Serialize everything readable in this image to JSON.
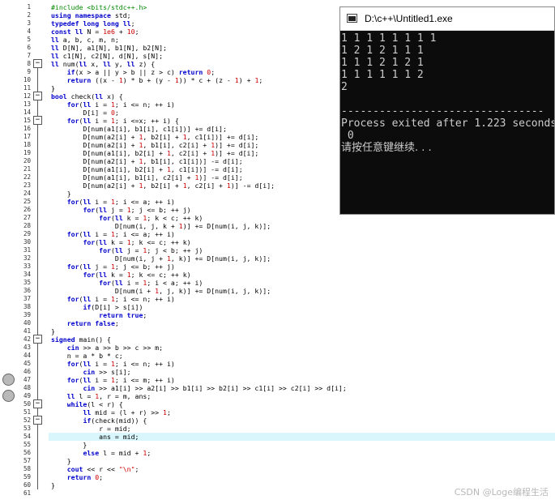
{
  "editor": {
    "lines": [
      "#include <bits/stdc++.h>",
      "using namespace std;",
      "typedef long long ll;",
      "const ll N = 1e6 + 10;",
      "ll a, b, c, m, n;",
      "ll D[N], a1[N], b1[N], b2[N];",
      "ll c1[N], c2[N], d[N], s[N];",
      "ll num(ll x, ll y, ll z) {",
      "    if(x > a || y > b || z > c) return 0;",
      "    return ((x - 1) * b + (y - 1)) * c + (z - 1) + 1;",
      "}",
      "bool check(ll x) {",
      "    for(ll i = 1; i <= n; ++ i)",
      "        D[i] = 0;",
      "    for(ll i = 1; i <=x; ++ i) {",
      "        D[num(a1[i], b1[i], c1[i])] += d[i];",
      "        D[num(a2[i] + 1, b2[i] + 1, c1[i])] += d[i];",
      "        D[num(a2[i] + 1, b1[i], c2[i] + 1)] += d[i];",
      "        D[num(a1[i], b2[i] + 1, c2[i] + 1)] += d[i];",
      "        D[num(a2[i] + 1, b1[i], c1[i])] -= d[i];",
      "        D[num(a1[i], b2[i] + 1, c1[i])] -= d[i];",
      "        D[num(a1[i], b1[i], c2[i] + 1)] -= d[i];",
      "        D[num(a2[i] + 1, b2[i] + 1, c2[i] + 1)] -= d[i];",
      "    }",
      "    for(ll i = 1; i <= a; ++ i)",
      "        for(ll j = 1; j <= b; ++ j)",
      "            for(ll k = 1; k < c; ++ k)",
      "                D[num(i, j, k + 1)] += D[num(i, j, k)];",
      "    for(ll i = 1; i <= a; ++ i)",
      "        for(ll k = 1; k <= c; ++ k)",
      "            for(ll j = 1; j < b; ++ j)",
      "                D[num(i, j + 1, k)] += D[num(i, j, k)];",
      "    for(ll j = 1; j <= b; ++ j)",
      "        for(ll k = 1; k <= c; ++ k)",
      "            for(ll i = 1; i < a; ++ i)",
      "                D[num(i + 1, j, k)] += D[num(i, j, k)];",
      "    for(ll i = 1; i <= n; ++ i)",
      "        if(D[i] > s[i])",
      "            return true;",
      "    return false;",
      "}",
      "signed main() {",
      "    cin >> a >> b >> c >> m;",
      "    n = a * b * c;",
      "    for(ll i = 1; i <= n; ++ i)",
      "        cin >> s[i];",
      "    for(ll i = 1; i <= m; ++ i)",
      "        cin >> a1[i] >> a2[i] >> b1[i] >> b2[i] >> c1[i] >> c2[i] >> d[i];",
      "    ll l = 1, r = m, ans;",
      "    while(l < r) {",
      "        ll mid = (l + r) >> 1;",
      "        if(check(mid)) {",
      "            r = mid;",
      "            ans = mid;",
      "        }",
      "        else l = mid + 1;",
      "    }",
      "    cout << r << \"\\n\";",
      "    return 0;",
      "}",
      ""
    ],
    "highlighted_line": 54,
    "breakpoint_lines": [
      47,
      49
    ],
    "fold_lines": [
      8,
      12,
      15,
      42,
      50,
      52
    ],
    "fold_symbol": "−"
  },
  "console": {
    "title": "D:\\c++\\Untitled1.exe",
    "output": [
      "1 1 1 1 1 1 1 1",
      "1 2 1 2 1 1 1",
      "1 1 1 2 1 2 1",
      "1 1 1 1 1 1 2",
      "2",
      "",
      "--------------------------------",
      "Process exited after 1.223 seconds",
      " 0",
      "请按任意键继续. . ."
    ]
  },
  "watermark": "CSDN @Loge编程生活"
}
